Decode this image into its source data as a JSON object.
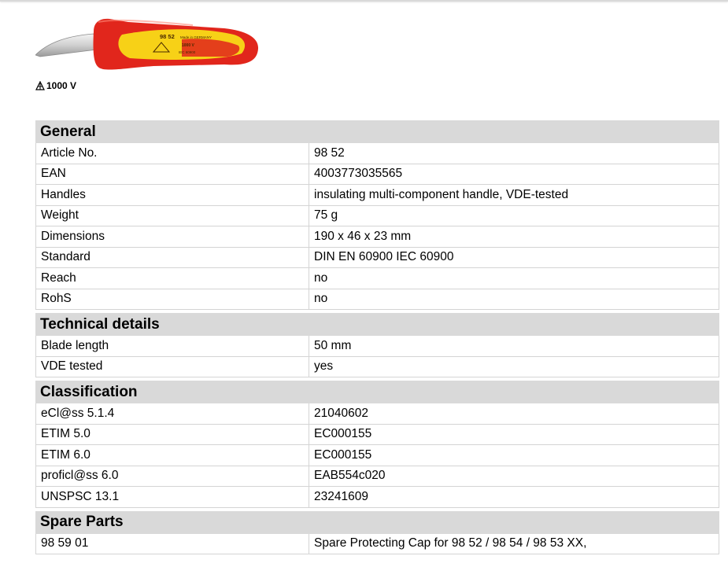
{
  "product": {
    "image_icon": "cable-knife-image",
    "voltage_icon": "insulation-triangle-icon",
    "voltage_label": "1000 V",
    "imprint": {
      "article": "98 52",
      "origin": "Made in GERMANY",
      "voltage": "1000 V",
      "standard": "IEC 60900"
    }
  },
  "colors": {
    "handle_red": "#e1261c",
    "handle_yellow": "#f7d117",
    "header_bg": "#d9d9d9"
  },
  "sections": [
    {
      "title": "General",
      "rows": [
        {
          "label": "Article No.",
          "value": "98 52"
        },
        {
          "label": "EAN",
          "value": "4003773035565"
        },
        {
          "label": "Handles",
          "value": "insulating multi-component handle, VDE-tested"
        },
        {
          "label": "Weight",
          "value": "75 g"
        },
        {
          "label": "Dimensions",
          "value": "190 x 46 x 23 mm"
        },
        {
          "label": "Standard",
          "value": "DIN EN 60900 IEC 60900"
        },
        {
          "label": "Reach",
          "value": "no"
        },
        {
          "label": "RohS",
          "value": "no"
        }
      ]
    },
    {
      "title": "Technical details",
      "rows": [
        {
          "label": "Blade length",
          "value": "50 mm"
        },
        {
          "label": "VDE tested",
          "value": "yes"
        }
      ]
    },
    {
      "title": "Classification",
      "rows": [
        {
          "label": "eCl@ss 5.1.4",
          "value": "21040602"
        },
        {
          "label": "ETIM 5.0",
          "value": "EC000155"
        },
        {
          "label": "ETIM 6.0",
          "value": "EC000155"
        },
        {
          "label": "proficl@ss 6.0",
          "value": "EAB554c020"
        },
        {
          "label": "UNSPSC 13.1",
          "value": "23241609"
        }
      ]
    },
    {
      "title": "Spare Parts",
      "rows": [
        {
          "label": "98 59 01",
          "value": "Spare Protecting Cap for 98 52 / 98 54 / 98 53 XX,"
        }
      ]
    }
  ]
}
